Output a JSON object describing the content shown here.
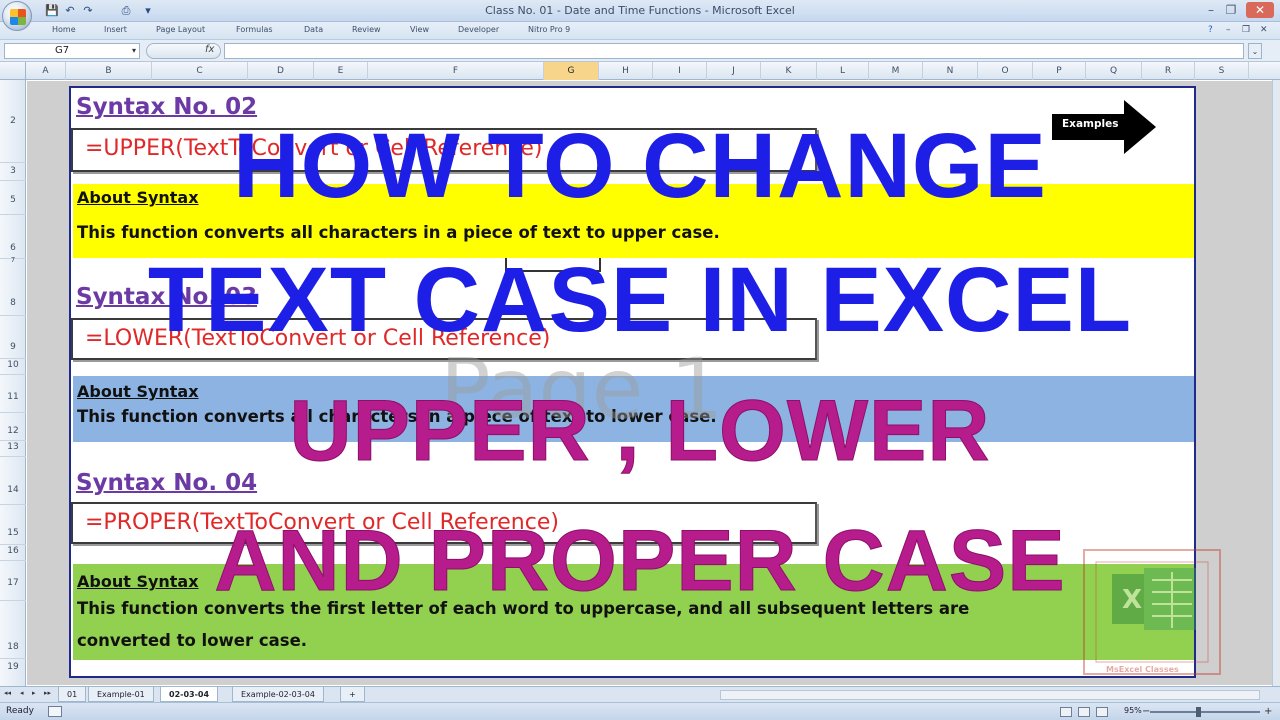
{
  "window": {
    "title": "Class No. 01 - Date and Time Functions - Microsoft Excel",
    "controls": {
      "minimize": "–",
      "restore": "❐",
      "close": "✕"
    },
    "inner_controls": {
      "minimize": "–",
      "restore": "❐",
      "close": "✕"
    }
  },
  "quick_access": {
    "save": "💾",
    "undo": "↶",
    "redo": "↷",
    "print": "⎙",
    "customize": "▾"
  },
  "ribbon": {
    "tabs": [
      "Home",
      "Insert",
      "Page Layout",
      "Formulas",
      "Data",
      "Review",
      "View",
      "Developer",
      "Nitro Pro 9"
    ],
    "help": "?"
  },
  "formula_bar": {
    "name_box": "G7",
    "fx": "fx",
    "formula": "",
    "expand": "⌄"
  },
  "grid": {
    "columns": [
      "A",
      "B",
      "C",
      "D",
      "E",
      "F",
      "G",
      "H",
      "I",
      "J",
      "K",
      "L",
      "M",
      "N",
      "O",
      "P",
      "Q",
      "R",
      "S"
    ],
    "selected_column": "G",
    "rows": [
      "2",
      "3",
      "5",
      "6",
      "7",
      "8",
      "9",
      "10",
      "11",
      "12",
      "13",
      "14",
      "15",
      "16",
      "17",
      "18",
      "19"
    ]
  },
  "content": {
    "syntax2": {
      "title": "Syntax No. 02",
      "formula": "=UPPER(TextToConvert or Cell Reference)"
    },
    "about1": {
      "label": "About Syntax",
      "text": "This function converts all characters in a piece of text to upper case."
    },
    "syntax3": {
      "title": "Syntax No. 03",
      "formula": "=LOWER(TextToConvert or Cell Reference)"
    },
    "about2": {
      "label": "About Syntax",
      "text": "This function converts all characters in a piece of text to lower case."
    },
    "syntax4": {
      "title": "Syntax No. 04",
      "formula": "=PROPER(TextToConvert or Cell Reference)"
    },
    "about3": {
      "label": "About Syntax",
      "text_line1": "This function converts the first letter of each word to uppercase, and all subsequent letters are",
      "text_line2": "converted to lower case."
    },
    "examples_button": "Examples",
    "watermark": "Page 1",
    "brand": {
      "name": "MsExcel Classes"
    }
  },
  "overlay": {
    "line1": "HOW TO CHANGE",
    "line2": "TEXT CASE IN EXCEL",
    "line3": "UPPER , LOWER",
    "line4": "AND PROPER CASE",
    "colors": {
      "blue": "#1d1ee6",
      "magenta": "#b71c8c"
    }
  },
  "sheet_tabs": {
    "nav": [
      "◂◂",
      "◂",
      "▸",
      "▸▸"
    ],
    "tabs": [
      "01",
      "Example-01",
      "02-03-04",
      "Example-02-03-04"
    ],
    "active": "02-03-04",
    "new_tab": "+"
  },
  "status": {
    "ready": "Ready",
    "zoom": "95%",
    "zoom_out": "−",
    "zoom_in": "+"
  },
  "colors": {
    "band_yellow": "#ffff00",
    "band_blue": "#8db3e2",
    "band_green": "#92d050",
    "title_purple": "#6b3aa5",
    "formula_red": "#e02828"
  }
}
